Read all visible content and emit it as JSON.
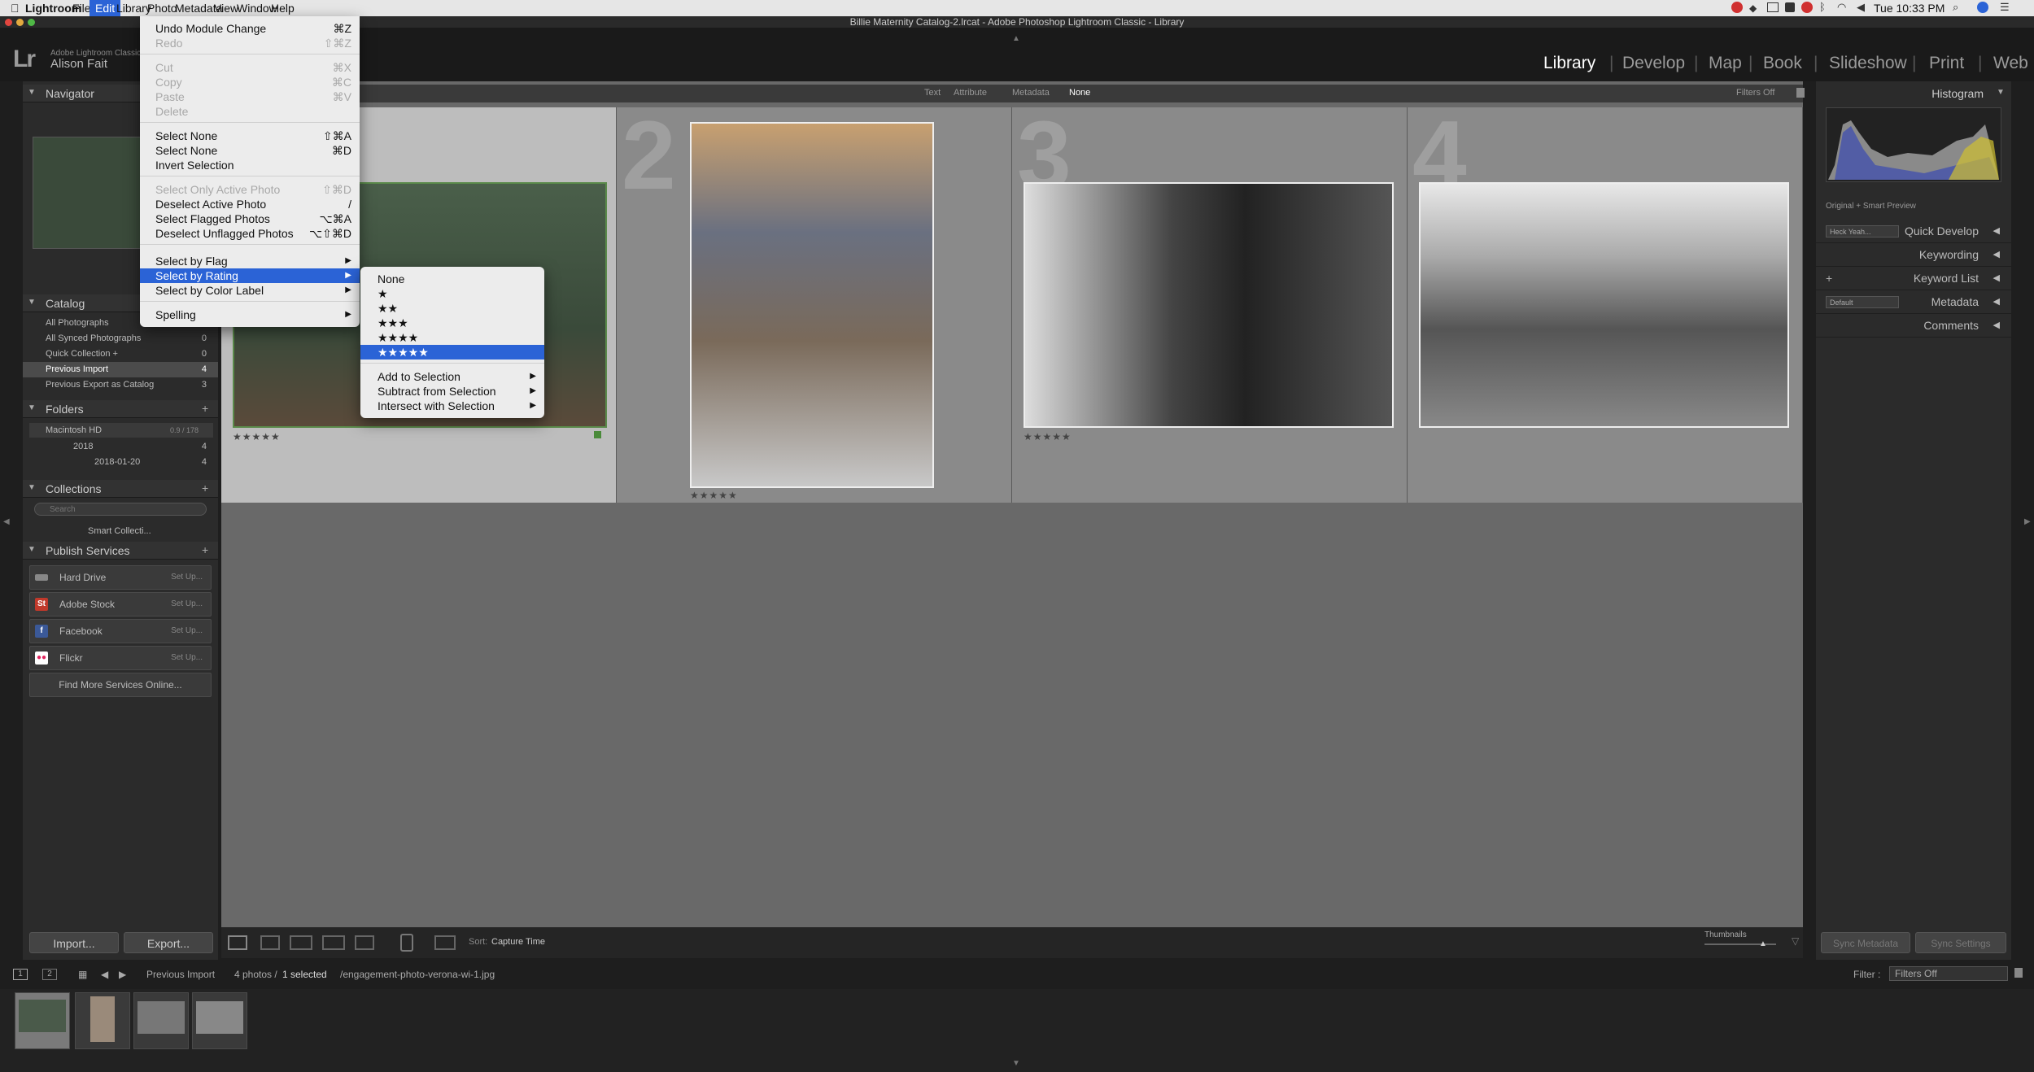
{
  "menubar": {
    "apple": "",
    "items": [
      "Lightroom",
      "File",
      "Edit",
      "Library",
      "Photo",
      "Metadata",
      "View",
      "Window",
      "Help"
    ],
    "right": {
      "time": "Tue 10:33 PM"
    }
  },
  "window": {
    "title": "Billie Maternity Catalog-2.lrcat - Adobe Photoshop Lightroom Classic - Library"
  },
  "identity": {
    "product": "Adobe Lightroom Classic",
    "user": "Alison Fait",
    "logo": "Lr"
  },
  "modules": [
    "Library",
    "Develop",
    "Map",
    "Book",
    "Slideshow",
    "Print",
    "Web"
  ],
  "left_panel": {
    "navigator": "Navigator",
    "catalog": {
      "title": "Catalog",
      "items": [
        {
          "label": "All Photographs",
          "count": "4"
        },
        {
          "label": "All Synced Photographs",
          "count": "0"
        },
        {
          "label": "Quick Collection +",
          "count": "0"
        },
        {
          "label": "Previous Import",
          "count": "4"
        },
        {
          "label": "Previous Export as Catalog",
          "count": "3"
        }
      ]
    },
    "folders": {
      "title": "Folders",
      "volume": "Macintosh HD",
      "volume_info": "0.9 / 178",
      "items": [
        {
          "label": "2018",
          "count": "4"
        },
        {
          "label": "2018-01-20",
          "count": "4"
        }
      ]
    },
    "collections": {
      "title": "Collections",
      "search_placeholder": "Search",
      "items": [
        "Smart Collecti..."
      ]
    },
    "publish": {
      "title": "Publish Services",
      "items": [
        {
          "label": "Hard Drive",
          "setup": "Set Up..."
        },
        {
          "label": "Adobe Stock",
          "setup": "Set Up..."
        },
        {
          "label": "Facebook",
          "setup": "Set Up..."
        },
        {
          "label": "Flickr",
          "setup": "Set Up..."
        }
      ],
      "find_more": "Find More Services Online..."
    },
    "import": "Import...",
    "export": "Export..."
  },
  "filter_bar": {
    "items": [
      "Text",
      "Attribute",
      "Metadata",
      "None"
    ],
    "filters_off": "Filters Off"
  },
  "grid": {
    "cells": [
      {
        "num": "1",
        "stars": "★★★★★",
        "selected": true
      },
      {
        "num": "2",
        "stars": "★★★★★"
      },
      {
        "num": "3",
        "stars": "★★★★★"
      },
      {
        "num": "4",
        "stars": ""
      }
    ]
  },
  "toolbar": {
    "sort_label": "Sort:",
    "sort_value": "Capture Time",
    "thumbnails": "Thumbnails"
  },
  "right_panel": {
    "histogram": "Histogram",
    "histogram_caption": "Original + Smart Preview",
    "quick_develop": "Quick Develop",
    "preset": "Heck Yeah...",
    "keywording": "Keywording",
    "keyword_list": "Keyword List",
    "metadata": "Metadata",
    "metadata_preset": "Default",
    "comments": "Comments",
    "sync_metadata": "Sync Metadata",
    "sync_settings": "Sync Settings"
  },
  "filmstrip": {
    "pages": [
      "1",
      "2"
    ],
    "source": "Previous Import",
    "count": "4 photos /",
    "selected": "1 selected",
    "file": "/engagement-photo-verona-wi-1.jpg",
    "filter_label": "Filter :",
    "filter_value": "Filters Off"
  },
  "edit_menu": {
    "items": [
      {
        "label": "Undo Module Change",
        "shortcut": "⌘Z"
      },
      {
        "label": "Redo",
        "shortcut": "⇧⌘Z",
        "disabled": true
      },
      {
        "label": "Cut",
        "shortcut": "⌘X",
        "disabled": true
      },
      {
        "label": "Copy",
        "shortcut": "⌘C",
        "disabled": true
      },
      {
        "label": "Paste",
        "shortcut": "⌘V",
        "disabled": true
      },
      {
        "label": "Delete",
        "shortcut": "",
        "disabled": true
      },
      {
        "label": "Select None",
        "shortcut": "⇧⌘A"
      },
      {
        "label": "Select None",
        "shortcut": "⌘D"
      },
      {
        "label": "Invert Selection",
        "shortcut": ""
      },
      {
        "label": "Select Only Active Photo",
        "shortcut": "⇧⌘D",
        "disabled": true
      },
      {
        "label": "Deselect Active Photo",
        "shortcut": "/"
      },
      {
        "label": "Select Flagged Photos",
        "shortcut": "⌥⌘A"
      },
      {
        "label": "Deselect Unflagged Photos",
        "shortcut": "⌥⇧⌘D"
      },
      {
        "label": "Select by Flag",
        "shortcut": ""
      },
      {
        "label": "Select by Rating",
        "shortcut": ""
      },
      {
        "label": "Select by Color Label",
        "shortcut": ""
      },
      {
        "label": "Spelling",
        "shortcut": ""
      }
    ]
  },
  "rating_submenu": {
    "items": [
      "None",
      "★",
      "★★",
      "★★★",
      "★★★★",
      "★★★★★",
      "Add to Selection",
      "Subtract from Selection",
      "Intersect with Selection"
    ]
  },
  "colors": {
    "accent": "#2b63d6",
    "selection_border": "#5a8a4a"
  }
}
